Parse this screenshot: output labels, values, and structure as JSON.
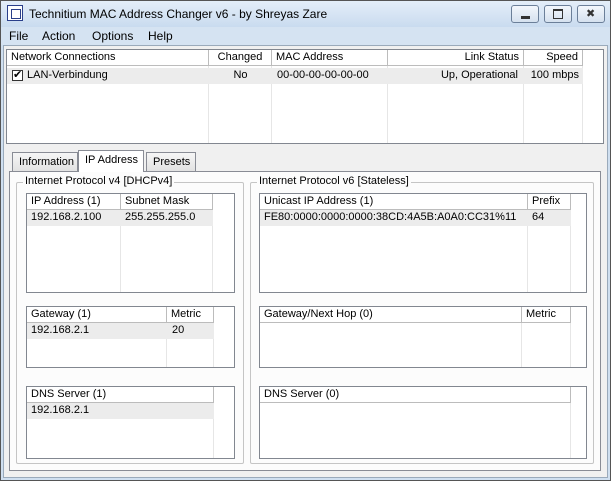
{
  "window": {
    "title": "Technitium MAC Address Changer v6 - by Shreyas Zare"
  },
  "menu": [
    "File",
    "Action",
    "Options",
    "Help"
  ],
  "connections": {
    "headers": [
      "Network Connections",
      "Changed",
      "MAC Address",
      "Link Status",
      "Speed"
    ],
    "rows": [
      {
        "checked": true,
        "name": "LAN-Verbindung",
        "changed": "No",
        "mac": "00-00-00-00-00-00",
        "link_status": "Up, Operational",
        "speed": "100 mbps"
      }
    ]
  },
  "tabs": [
    "Information",
    "IP Address",
    "Presets"
  ],
  "active_tab": "IP Address",
  "ipv4": {
    "group_title": "Internet Protocol v4 [DHCPv4]",
    "address_headers": [
      "IP Address (1)",
      "Subnet Mask"
    ],
    "addresses": [
      {
        "ip": "192.168.2.100",
        "mask": "255.255.255.0"
      }
    ],
    "gateway_headers": [
      "Gateway (1)",
      "Metric"
    ],
    "gateways": [
      {
        "gateway": "192.168.2.1",
        "metric": "20"
      }
    ],
    "dns_header": "DNS Server (1)",
    "dns": [
      "192.168.2.1"
    ]
  },
  "ipv6": {
    "group_title": "Internet Protocol v6 [Stateless]",
    "address_headers": [
      "Unicast IP Address (1)",
      "Prefix"
    ],
    "addresses": [
      {
        "ip": "FE80:0000:0000:0000:38CD:4A5B:A0A0:CC31%11",
        "prefix": "64"
      }
    ],
    "gateway_headers": [
      "Gateway/Next Hop (0)",
      "Metric"
    ],
    "dns_header": "DNS Server (0)"
  }
}
